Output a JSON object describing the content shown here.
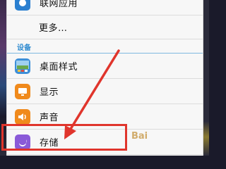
{
  "list": {
    "items": [
      {
        "label": "联网应用",
        "icon": "app-icon"
      },
      {
        "label": "更多…",
        "icon": ""
      },
      {
        "label": "桌面样式",
        "icon": "desktop-style-icon"
      },
      {
        "label": "显示",
        "icon": "display-icon"
      },
      {
        "label": "声音",
        "icon": "sound-icon"
      },
      {
        "label": "存储",
        "icon": "storage-icon"
      }
    ],
    "section_header": "设备"
  },
  "watermark": "Bai",
  "colors": {
    "accent": "#2f8bd0",
    "highlight": "#e0352c",
    "icon_orange": "#f08a1c",
    "icon_purple": "#8a5ad8"
  }
}
